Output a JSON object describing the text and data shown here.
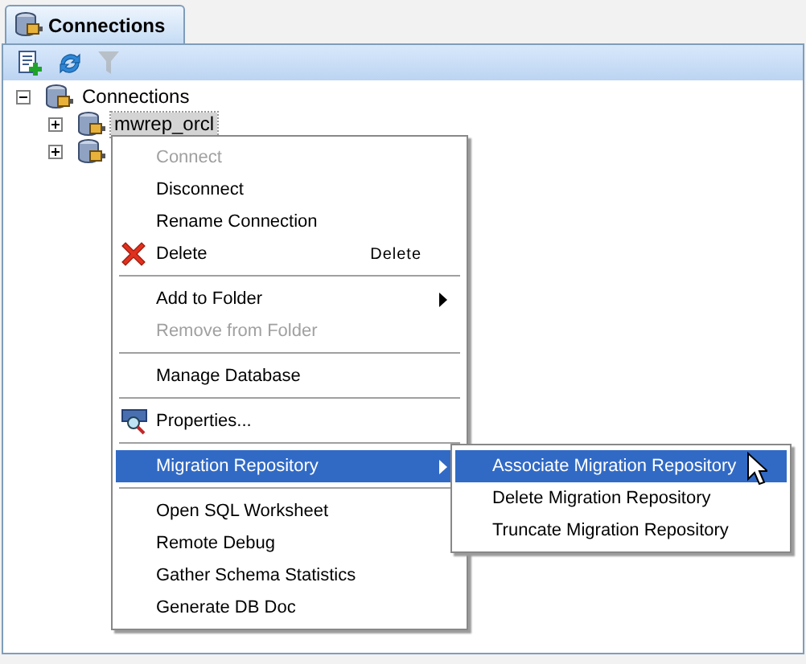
{
  "tab": {
    "title": "Connections",
    "selected": true
  },
  "toolbar": [
    {
      "kind": "new-connection",
      "disabled": false
    },
    {
      "kind": "refresh",
      "disabled": false
    },
    {
      "kind": "filter",
      "disabled": true
    }
  ],
  "tree": [
    {
      "label": "Connections",
      "expanded": true,
      "children": [
        {
          "label": "mwrep_orcl",
          "expanded": false,
          "selected": true
        },
        {
          "expanded": false
        }
      ]
    }
  ],
  "context_menu": {
    "items": [
      {
        "kind": "item",
        "label": "Connect",
        "disabled": true,
        "selected": false
      },
      {
        "kind": "item",
        "label": "Disconnect",
        "disabled": false,
        "selected": false
      },
      {
        "kind": "item",
        "label": "Rename Connection",
        "disabled": false,
        "selected": false
      },
      {
        "kind": "item",
        "label": "Delete",
        "shortcut": "Delete",
        "disabled": false,
        "selected": false
      },
      {
        "kind": "separator"
      },
      {
        "kind": "item",
        "label": "Add to Folder",
        "has_submenu": true,
        "disabled": false,
        "selected": false
      },
      {
        "kind": "item",
        "label": "Remove from Folder",
        "disabled": true,
        "selected": false
      },
      {
        "kind": "separator"
      },
      {
        "kind": "item",
        "label": "Manage Database",
        "disabled": false,
        "selected": false
      },
      {
        "kind": "separator"
      },
      {
        "kind": "item",
        "label": "Properties...",
        "disabled": false,
        "selected": false
      },
      {
        "kind": "separator"
      },
      {
        "kind": "item",
        "label": "Migration Repository",
        "has_submenu": true,
        "disabled": false,
        "selected": true
      },
      {
        "kind": "separator"
      },
      {
        "kind": "item",
        "label": "Open SQL Worksheet",
        "disabled": false,
        "selected": false
      },
      {
        "kind": "item",
        "label": "Remote Debug",
        "disabled": false,
        "selected": false
      },
      {
        "kind": "item",
        "label": "Gather Schema Statistics",
        "disabled": false,
        "selected": false
      },
      {
        "kind": "item",
        "label": "Generate DB Doc",
        "disabled": false,
        "selected": false
      }
    ]
  },
  "submenu": {
    "items": [
      {
        "kind": "item",
        "label": "Associate Migration Repository",
        "disabled": false,
        "selected": true
      },
      {
        "kind": "item",
        "label": "Delete Migration Repository",
        "disabled": false,
        "selected": false
      },
      {
        "kind": "item",
        "label": "Truncate Migration Repository",
        "disabled": false,
        "selected": false
      }
    ]
  }
}
